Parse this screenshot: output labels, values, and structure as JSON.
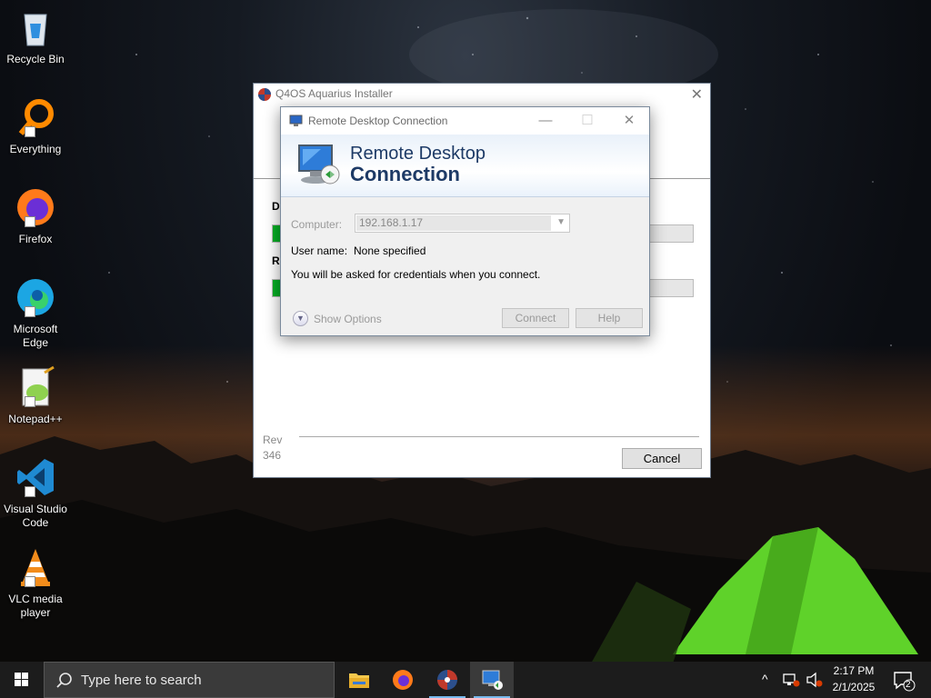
{
  "desktop": {
    "icons": [
      {
        "label": "Recycle Bin"
      },
      {
        "label": "Everything"
      },
      {
        "label": "Firefox"
      },
      {
        "label": "Microsoft Edge"
      },
      {
        "label": "Notepad++"
      },
      {
        "label": "Visual Studio Code"
      },
      {
        "label": "VLC media player"
      }
    ]
  },
  "installer": {
    "title": "Q4OS Aquarius Installer",
    "label1": "D",
    "label2": "R",
    "progress1": 0.025,
    "progress2": 0.025,
    "rev_line1": "Rev",
    "rev_line2": "346",
    "cancel_label": "Cancel"
  },
  "rdc": {
    "title": "Remote Desktop Connection",
    "banner_line1": "Remote Desktop",
    "banner_line2": "Connection",
    "computer_label": "Computer:",
    "computer_value": "192.168.1.17",
    "username_label": "User name:",
    "username_value": "None specified",
    "info": "You will be asked for credentials when you connect.",
    "show_options": "Show Options",
    "connect_label": "Connect",
    "help_label": "Help"
  },
  "taskbar": {
    "search_placeholder": "Type here to search",
    "time": "2:17 PM",
    "date": "2/1/2025",
    "notification_count": "2"
  }
}
